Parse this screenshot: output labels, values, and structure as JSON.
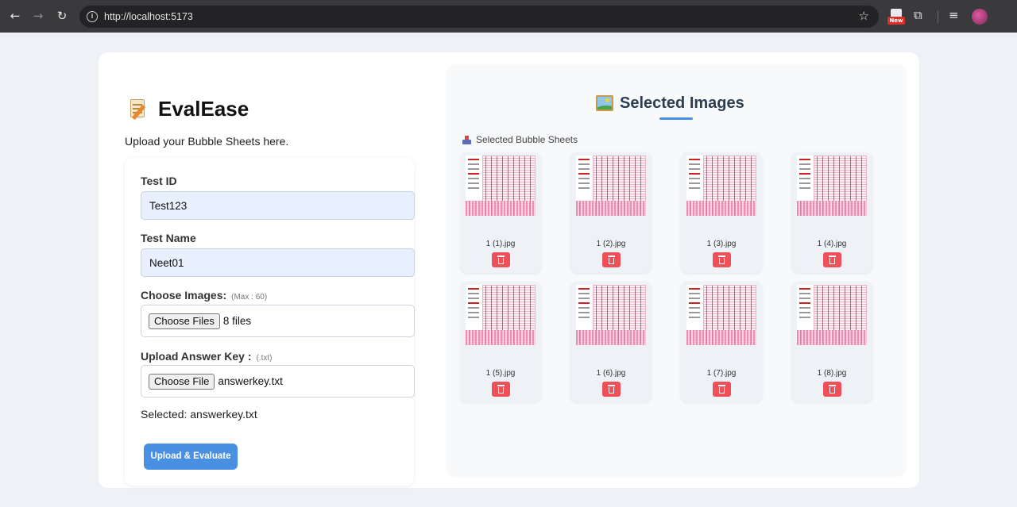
{
  "browser": {
    "url": "http://localhost:5173",
    "ext_badge": "New"
  },
  "app": {
    "brand": "EvalEase",
    "subtitle": "Upload your Bubble Sheets here."
  },
  "form": {
    "test_id_label": "Test ID",
    "test_id_value": "Test123",
    "test_name_label": "Test Name",
    "test_name_value": "Neet01",
    "images_label": "Choose Images:",
    "images_hint": "(Max : 60)",
    "images_button": "Choose Files",
    "images_status": "8 files",
    "answer_key_label": "Upload Answer Key :",
    "answer_key_hint": "(.txt)",
    "answer_key_button": "Choose File",
    "answer_key_status": "answerkey.txt",
    "selected_text": "Selected: answerkey.txt",
    "submit_label": "Upload & Evaluate"
  },
  "images_panel": {
    "title": "Selected Images",
    "section_label": "Selected Bubble Sheets",
    "items": [
      {
        "name": "1 (1).jpg"
      },
      {
        "name": "1 (2).jpg"
      },
      {
        "name": "1 (3).jpg"
      },
      {
        "name": "1 (4).jpg"
      },
      {
        "name": "1 (5).jpg"
      },
      {
        "name": "1 (6).jpg"
      },
      {
        "name": "1 (7).jpg"
      },
      {
        "name": "1 (8).jpg"
      }
    ]
  },
  "colors": {
    "accent": "#4a90e2",
    "delete": "#ef4f57",
    "input_fill": "#e8f0fe"
  }
}
